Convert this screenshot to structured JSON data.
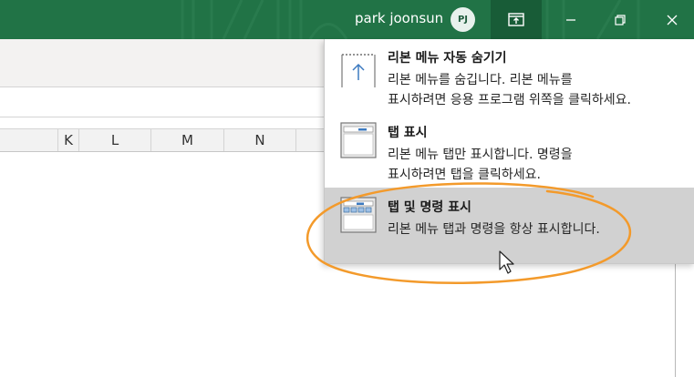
{
  "titlebar": {
    "user_name": "park joonsun",
    "avatar_initials": "PJ",
    "accent": "#217346"
  },
  "columns": [
    "K",
    "L",
    "M",
    "N"
  ],
  "ribbon_display_menu": {
    "items": [
      {
        "title": "리본 메뉴 자동 숨기기",
        "desc1": "리본 메뉴를 숨깁니다. 리본 메뉴를",
        "desc2": "표시하려면 응용 프로그램 위쪽을 클릭하세요.",
        "icon": "auto-hide-ribbon-icon"
      },
      {
        "title": "탭 표시",
        "desc1": "리본 메뉴 탭만 표시합니다. 명령을",
        "desc2": "표시하려면 탭을 클릭하세요.",
        "icon": "show-tabs-icon"
      },
      {
        "title": "탭 및 명령 표시",
        "desc1": "리본 메뉴 탭과 명령을 항상 표시합니다.",
        "icon": "show-tabs-commands-icon",
        "selected": true
      }
    ]
  },
  "annotation_color": "#f39a2b"
}
